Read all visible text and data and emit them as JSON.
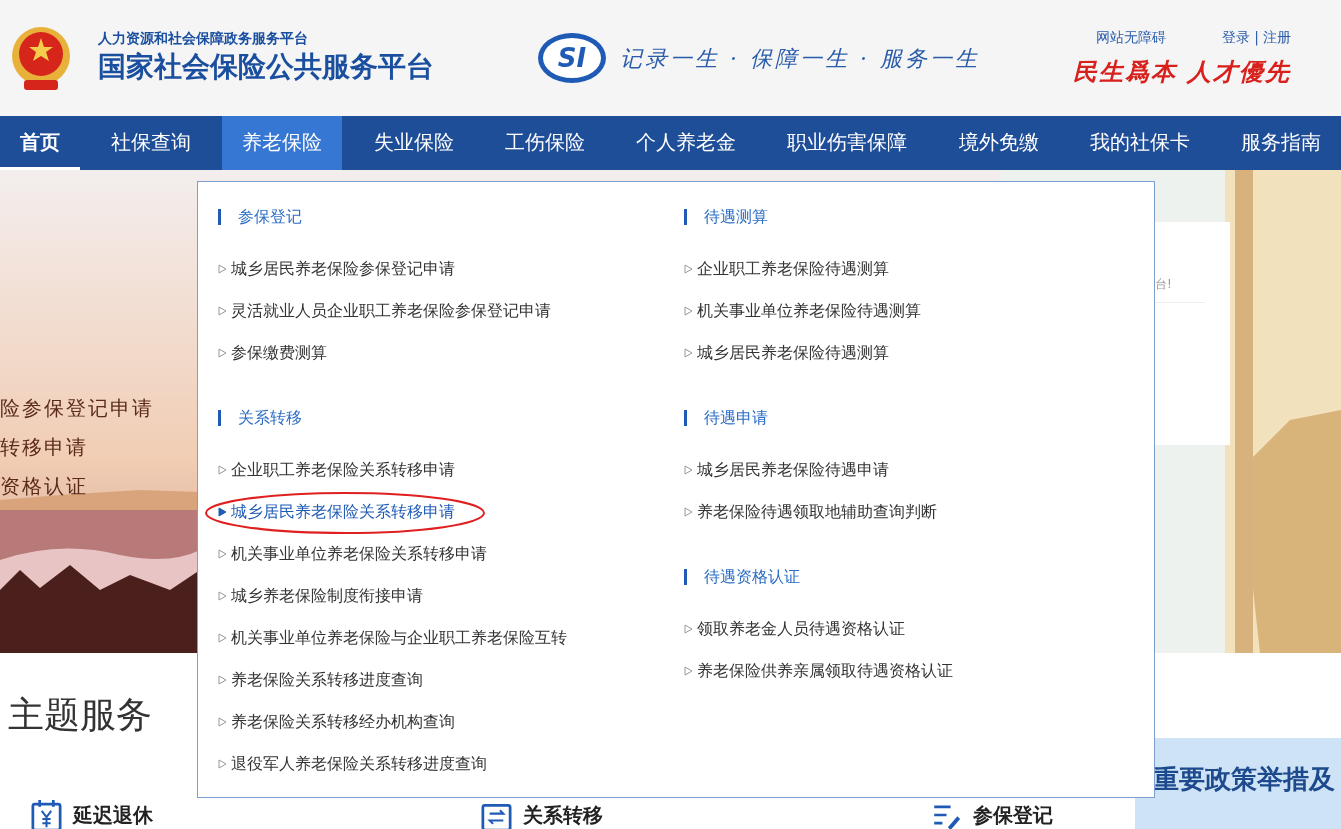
{
  "header": {
    "subtitle": "人力资源和社会保障政务服务平台",
    "title": "国家社会保险公共服务平台",
    "logo_text": "SI",
    "slogan": "记录一生 · 保障一生 · 服务一生",
    "accessibility_link": "网站无障碍",
    "login": "登录",
    "separator": "|",
    "register": "注册",
    "motto": "民生爲本 人才優先"
  },
  "nav": [
    {
      "label": "首页",
      "current": true,
      "selected": false
    },
    {
      "label": "社保查询",
      "current": false,
      "selected": false
    },
    {
      "label": "养老保险",
      "current": false,
      "selected": true
    },
    {
      "label": "失业保险",
      "current": false,
      "selected": false
    },
    {
      "label": "工伤保险",
      "current": false,
      "selected": false
    },
    {
      "label": "个人养老金",
      "current": false,
      "selected": false
    },
    {
      "label": "职业伤害保障",
      "current": false,
      "selected": false
    },
    {
      "label": "境外免缴",
      "current": false,
      "selected": false
    },
    {
      "label": "我的社保卡",
      "current": false,
      "selected": false
    },
    {
      "label": "服务指南",
      "current": false,
      "selected": false
    }
  ],
  "banner": {
    "lines": [
      "险参保登记申请",
      "转移申请",
      "资格认证"
    ],
    "notice": "台!"
  },
  "menu": {
    "columns": [
      {
        "sections": [
          {
            "title": "参保登记",
            "items": [
              {
                "label": "城乡居民养老保险参保登记申请",
                "selected": false
              },
              {
                "label": "灵活就业人员企业职工养老保险参保登记申请",
                "selected": false
              },
              {
                "label": "参保缴费测算",
                "selected": false
              }
            ]
          },
          {
            "title": "关系转移",
            "items": [
              {
                "label": "企业职工养老保险关系转移申请",
                "selected": false
              },
              {
                "label": "城乡居民养老保险关系转移申请",
                "selected": true
              },
              {
                "label": "机关事业单位养老保险关系转移申请",
                "selected": false
              },
              {
                "label": "城乡养老保险制度衔接申请",
                "selected": false
              },
              {
                "label": "机关事业单位养老保险与企业职工养老保险互转",
                "selected": false
              },
              {
                "label": "养老保险关系转移进度查询",
                "selected": false
              },
              {
                "label": "养老保险关系转移经办机构查询",
                "selected": false
              },
              {
                "label": "退役军人养老保险关系转移进度查询",
                "selected": false
              }
            ]
          }
        ]
      },
      {
        "sections": [
          {
            "title": "待遇测算",
            "items": [
              {
                "label": "企业职工养老保险待遇测算",
                "selected": false
              },
              {
                "label": "机关事业单位养老保险待遇测算",
                "selected": false
              },
              {
                "label": "城乡居民养老保险待遇测算",
                "selected": false
              }
            ]
          },
          {
            "title": "待遇申请",
            "items": [
              {
                "label": "城乡居民养老保险待遇申请",
                "selected": false
              },
              {
                "label": "养老保险待遇领取地辅助查询判断",
                "selected": false
              }
            ]
          },
          {
            "title": "待遇资格认证",
            "items": [
              {
                "label": "领取养老金人员待遇资格认证",
                "selected": false
              },
              {
                "label": "养老保险供养亲属领取待遇资格认证",
                "selected": false
              }
            ]
          }
        ]
      }
    ]
  },
  "theme": {
    "title": "主题服务",
    "cards": [
      {
        "label": "延迟退休",
        "kind": "retire"
      },
      {
        "label": "关系转移",
        "kind": "transfer"
      },
      {
        "label": "参保登记",
        "kind": "register"
      }
    ]
  },
  "policy_banner": {
    "title": "重要政策举措及"
  }
}
